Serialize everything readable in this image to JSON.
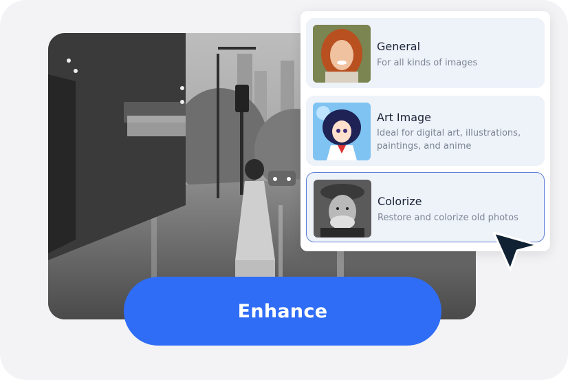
{
  "colors": {
    "accent": "#2f6df6",
    "panel_item_bg": "#eef2f9",
    "selected_border": "#5b7fd6",
    "cursor": "#0f2133"
  },
  "enhance_button": {
    "label": "Enhance"
  },
  "modes": [
    {
      "title": "General",
      "description": "For all kinds of images",
      "selected": false
    },
    {
      "title": "Art Image",
      "description": "Ideal for digital art, illustrations, paintings, and anime",
      "selected": false
    },
    {
      "title": "Colorize",
      "description": "Restore and colorize old photos",
      "selected": true
    }
  ],
  "icons": {
    "cursor": "mouse-pointer-icon"
  }
}
